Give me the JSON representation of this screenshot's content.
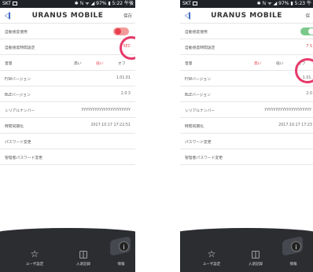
{
  "screens": {
    "left": {
      "status": {
        "carrier": "SKT",
        "right": "✱ ℕ ᯤ ◢ 97% ▮ 5:22 午後"
      },
      "header": {
        "title": "URANUS MOBILE",
        "save_label": "保存"
      },
      "rows": {
        "auto_lock": {
          "label": "自動感度使用",
          "toggle_state": "off"
        },
        "auto_lock_time": {
          "label": "自動感度時間設定",
          "value": "2 SEC"
        },
        "sound": {
          "label": "音量",
          "high": "高い",
          "low": "低い",
          "off": "オフ"
        },
        "fw": {
          "label": "F/Wバージョン",
          "value": "1.01.01"
        },
        "ble": {
          "label": "BLEバージョン",
          "value": "2.0.3"
        },
        "serial": {
          "label": "シリアルナンバー",
          "value": "yyyyyyyyyyyyyyyyyyyyyy"
        },
        "time_sync": {
          "label": "時間同期化",
          "value": "2017.10.17 17:22:51"
        },
        "password": {
          "label": "パスワード変更"
        },
        "admin_password": {
          "label": "管理者パスワード変更"
        }
      },
      "tabs": {
        "user": "ユーザ設定",
        "records": "入退記録",
        "info": "情報"
      }
    },
    "right": {
      "status": {
        "carrier": "SKT",
        "right": "✱ ℕ ᯤ ◢ 97% ▮ 5:23 午"
      },
      "header": {
        "title": "URANUS MOBILE",
        "save_label": "保"
      },
      "rows": {
        "auto_lock": {
          "label": "自動感度使用",
          "toggle_state": "on"
        },
        "auto_lock_time": {
          "label": "自動感度時間設定",
          "value": "7 S"
        },
        "sound": {
          "label": "音量",
          "high": "高い",
          "low": "低い",
          "off": "オフ"
        },
        "fw": {
          "label": "F/Wバージョン",
          "value": "1.01."
        },
        "ble": {
          "label": "BLEバージョン",
          "value": "2.0"
        },
        "serial": {
          "label": "シリアルナンバー",
          "value": "yyyyyyyyyyyyyyyyyyyyy"
        },
        "time_sync": {
          "label": "時間同期化",
          "value": "2017.10.17 17:23"
        },
        "password": {
          "label": "パスワード変更"
        },
        "admin_password": {
          "label": "管理者パスワード変更"
        }
      },
      "tabs": {
        "user": "ユーザ設定",
        "records": "入退記録",
        "info": "情報"
      }
    }
  },
  "colors": {
    "accent_red": "#e8414e",
    "annotation_pink": "#e63a6a",
    "toggle_on": "#7ac98a",
    "back_blue": "#3f6bc4",
    "tabbar": "#2b2d31"
  }
}
